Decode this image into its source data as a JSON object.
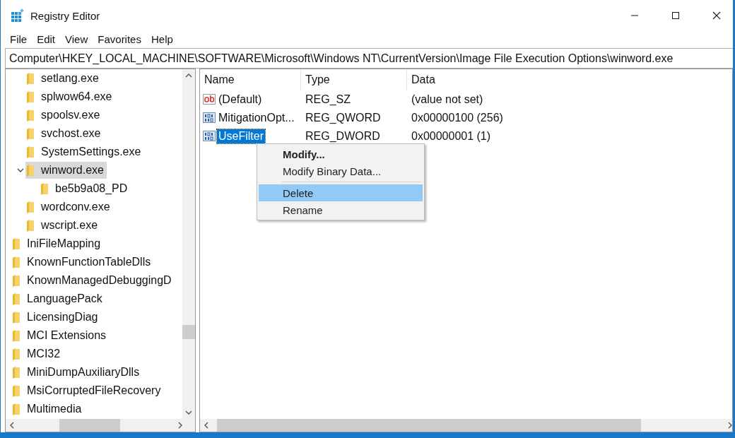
{
  "window": {
    "title": "Registry Editor"
  },
  "menu": [
    "File",
    "Edit",
    "View",
    "Favorites",
    "Help"
  ],
  "address": "Computer\\HKEY_LOCAL_MACHINE\\SOFTWARE\\Microsoft\\Windows NT\\CurrentVersion\\Image File Execution Options\\winword.exe",
  "tree": {
    "continued_children": [
      {
        "label": "setlang.exe",
        "selected": false
      },
      {
        "label": "splwow64.exe",
        "selected": false
      },
      {
        "label": "spoolsv.exe",
        "selected": false
      },
      {
        "label": "svchost.exe",
        "selected": false
      },
      {
        "label": "SystemSettings.exe",
        "selected": false
      },
      {
        "label": "winword.exe",
        "selected": true,
        "expanded": true,
        "children": [
          {
            "label": "be5b9a08_PD",
            "selected": false
          }
        ]
      },
      {
        "label": "wordconv.exe",
        "selected": false
      },
      {
        "label": "wscript.exe",
        "selected": false
      }
    ],
    "items": [
      {
        "label": "IniFileMapping",
        "selected": false
      },
      {
        "label": "KnownFunctionTableDlls",
        "selected": false
      },
      {
        "label": "KnownManagedDebuggingD",
        "selected": false
      },
      {
        "label": "LanguagePack",
        "selected": false
      },
      {
        "label": "LicensingDiag",
        "selected": false
      },
      {
        "label": "MCI Extensions",
        "selected": false
      },
      {
        "label": "MCI32",
        "selected": false
      },
      {
        "label": "MiniDumpAuxiliaryDlls",
        "selected": false
      },
      {
        "label": "MsiCorruptedFileRecovery",
        "selected": false
      },
      {
        "label": "Multimedia",
        "selected": false
      }
    ]
  },
  "values": {
    "columns": [
      "Name",
      "Type",
      "Data"
    ],
    "rows": [
      {
        "kind": "string",
        "name": "(Default)",
        "type": "REG_SZ",
        "data": "(value not set)",
        "selected": false
      },
      {
        "kind": "binary",
        "name": "MitigationOpt...",
        "type": "REG_QWORD",
        "data": "0x00000100 (256)",
        "selected": false
      },
      {
        "kind": "binary",
        "name": "UseFilter",
        "type": "REG_DWORD",
        "data": "0x00000001 (1)",
        "selected": true
      }
    ]
  },
  "context_menu": [
    {
      "label": "Modify...",
      "default": true,
      "selected": false,
      "separator_before": false
    },
    {
      "label": "Modify Binary Data...",
      "default": false,
      "selected": false,
      "separator_before": false
    },
    {
      "label": "Delete",
      "default": false,
      "selected": true,
      "separator_before": true
    },
    {
      "label": "Rename",
      "default": false,
      "selected": false,
      "separator_before": false
    }
  ]
}
